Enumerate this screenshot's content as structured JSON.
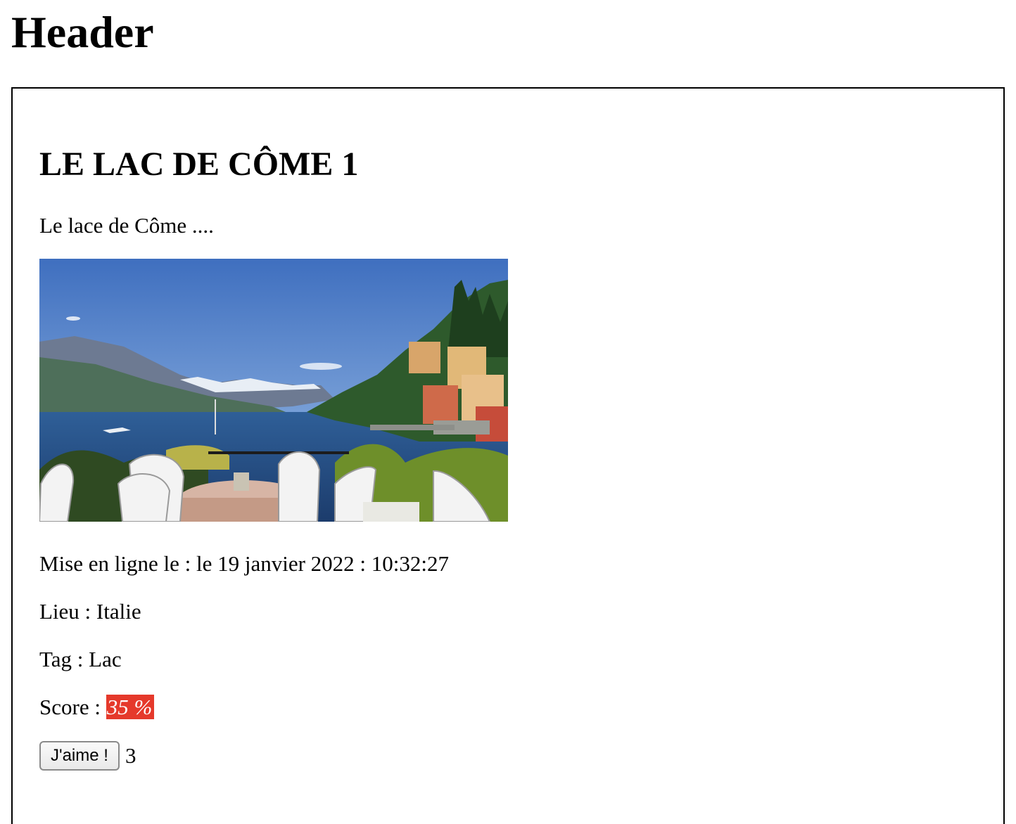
{
  "header": {
    "title": "Header"
  },
  "post": {
    "title": "LE LAC DE CÔME 1",
    "description": "Le lace de Côme ....",
    "image_alt": "Lac de Côme",
    "date_label": "Mise en ligne le : le 19 janvier 2022 : 10:32:27",
    "place_label": "Lieu : Italie",
    "tag_label": "Tag : Lac",
    "score_prefix": "Score : ",
    "score_value": "35 %",
    "score_color": "#e5392b",
    "like_button_label": "J'aime !",
    "like_count": "3"
  }
}
